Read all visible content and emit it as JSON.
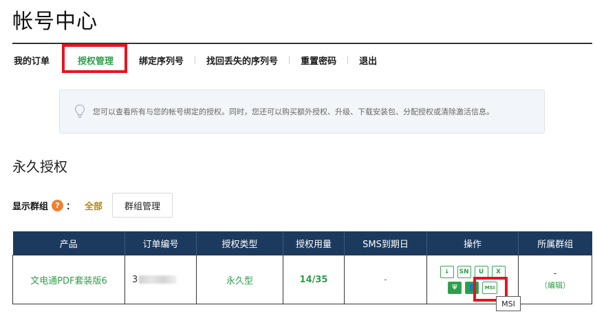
{
  "page": {
    "title": "帐号中心"
  },
  "tabs": [
    {
      "label": "我的订单"
    },
    {
      "label": "授权管理",
      "active": true
    },
    {
      "label": "绑定序列号"
    },
    {
      "label": "找回丢失的序列号"
    },
    {
      "label": "重置密码"
    },
    {
      "label": "退出"
    }
  ],
  "info": {
    "text": "您可以查看所有与您的帐号绑定的授权。同时，您还可以购买额外授权、升级、下载安装包、分配授权或清除激活信息。",
    "icon": "lightbulb-icon"
  },
  "section": {
    "title": "永久授权"
  },
  "group": {
    "label": "显示群组",
    "help": "?",
    "colon": "：",
    "all_link": "全部",
    "manage_button": "群组管理"
  },
  "table": {
    "headers": [
      "产品",
      "订单编号",
      "授权类型",
      "授权用量",
      "SMS到期日",
      "操作",
      "所属群组"
    ],
    "row": {
      "product": "文电通PDF套装版6",
      "order_prefix": "3",
      "type": "永久型",
      "usage": "14/35",
      "sms_expiry": "-",
      "group_value": "-",
      "group_edit": "（编辑）"
    },
    "ops_row1": [
      {
        "name": "download-icon",
        "label": "↓"
      },
      {
        "name": "sn-icon",
        "label": "SN"
      },
      {
        "name": "upgrade-icon",
        "label": "U"
      },
      {
        "name": "clear-icon",
        "label": "X"
      }
    ],
    "ops_row2": [
      {
        "name": "shield-icon",
        "label": "⛨"
      },
      {
        "name": "user-icon",
        "label": "👤"
      },
      {
        "name": "msi-icon",
        "label": "MSI"
      }
    ]
  },
  "tooltip": {
    "text": "MSI"
  },
  "colors": {
    "header_bg": "#1b3a5e",
    "accent_green": "#2e9e4a",
    "highlight_red": "#e8141c",
    "link_gold": "#b8860b"
  }
}
